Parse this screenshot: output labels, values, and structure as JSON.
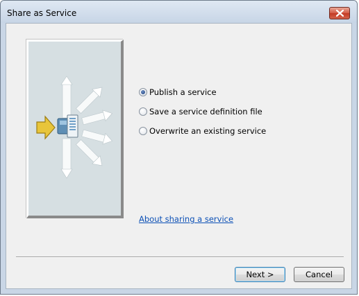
{
  "window": {
    "title": "Share as Service"
  },
  "options": {
    "items": [
      {
        "label": "Publish a service",
        "checked": true
      },
      {
        "label": "Save a service definition file",
        "checked": false
      },
      {
        "label": "Overwrite an existing service",
        "checked": false
      }
    ]
  },
  "links": {
    "about": "About sharing a service"
  },
  "buttons": {
    "next": "Next >",
    "cancel": "Cancel"
  },
  "icons": {
    "close": "close-icon",
    "illustration": "share-service-icon",
    "input_arrow": "arrow-right-icon",
    "server": "server-icon"
  },
  "colors": {
    "accent_link": "#0b4fb5",
    "close_button": "#c43a24",
    "illustration_bg": "#d6dfe2",
    "input_arrow": "#e3c33a"
  }
}
